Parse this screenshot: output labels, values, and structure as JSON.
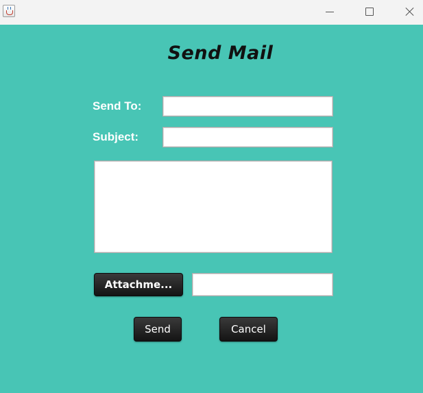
{
  "window": {
    "icon": "java-coffee-cup-icon",
    "controls": [
      "minimize-icon",
      "maximize-icon",
      "close-icon"
    ]
  },
  "heading": "Send Mail",
  "form": {
    "send_to_label": "Send To:",
    "send_to_value": "",
    "subject_label": "Subject:",
    "subject_value": "",
    "body_value": "",
    "attachment_button": "Attachme...",
    "attachment_value": ""
  },
  "actions": {
    "send": "Send",
    "cancel": "Cancel"
  },
  "colors": {
    "background": "#48c5b5",
    "titlebar": "#f3f3f3",
    "button_dark": "#222222",
    "label_text": "#ffffff",
    "heading_text": "#111111"
  }
}
